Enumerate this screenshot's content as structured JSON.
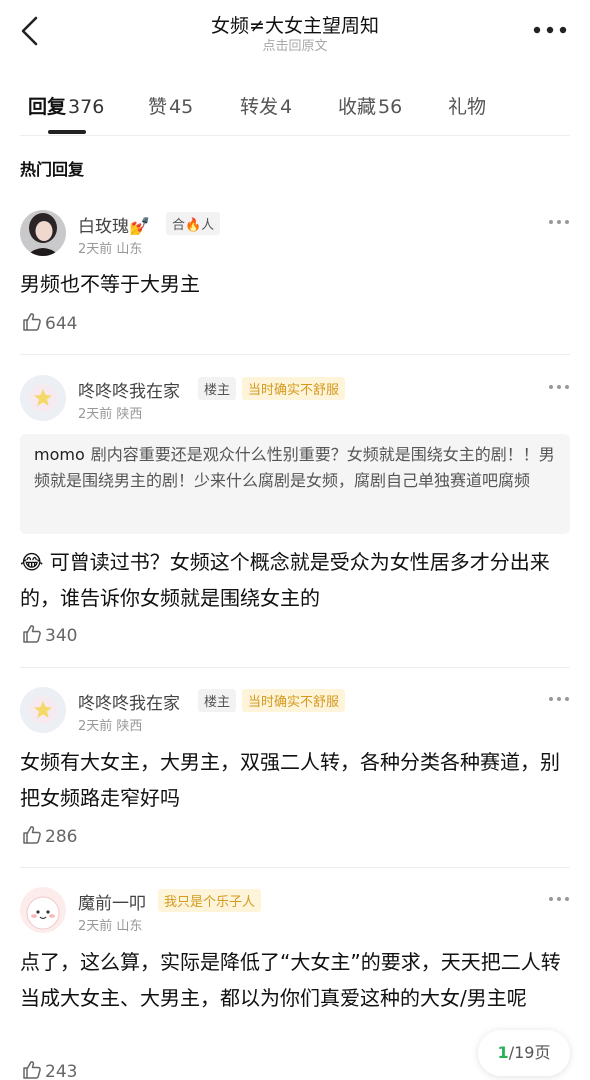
{
  "header": {
    "title": "女频≠大女主望周知",
    "subtitle": "点击回原文"
  },
  "tabs": [
    {
      "label": "回复",
      "count": "376"
    },
    {
      "label": "赞",
      "count": "45"
    },
    {
      "label": "转发",
      "count": "4"
    },
    {
      "label": "收藏",
      "count": "56"
    },
    {
      "label": "礼物",
      "count": ""
    }
  ],
  "section_title": "热门回复",
  "comments": [
    {
      "name": "白玫瑰💅",
      "badges": [
        "合🔥人"
      ],
      "time": "2天前",
      "location": "山东",
      "text": "男频也不等于大男主",
      "likes": "644"
    },
    {
      "name": "咚咚咚我在家",
      "badges": [
        "楼主",
        "当时确实不舒服"
      ],
      "time": "2天前",
      "location": "陕西",
      "quote_name": "momo",
      "quote_text": "剧内容重要还是观众什么性别重要？女频就是围绕女主的剧！！男频就是围绕男主的剧！少来什么腐剧是女频，腐剧自己单独赛道吧腐频",
      "text": "😂 可曾读过书？女频这个概念就是受众为女性居多才分出来的，谁告诉你女频就是围绕女主的",
      "likes": "340"
    },
    {
      "name": "咚咚咚我在家",
      "badges": [
        "楼主",
        "当时确实不舒服"
      ],
      "time": "2天前",
      "location": "陕西",
      "text": "女频有大女主，大男主，双强二人转，各种分类各种赛道，别把女频路走窄好吗",
      "likes": "286"
    },
    {
      "name": "魔前一叩",
      "badges": [
        "我只是个乐子人"
      ],
      "time": "2天前",
      "location": "山东",
      "text": "点了，这么算，实际是降低了“大女主”的要求，天天把二人转当成大女主、大男主，都以为你们真爱这种的大女/男主呢",
      "likes": "243"
    }
  ],
  "pager": {
    "current": "1",
    "total": "/19页"
  },
  "colors": {
    "accent_green": "#2bb05a",
    "badge_yellow_text": "#d49a1f",
    "badge_yellow_bg": "#fdf4d9"
  },
  "icons": [
    "back-arrow-icon",
    "more-icon",
    "dots-icon",
    "thumbs-up-icon",
    "avatar-star-icon"
  ]
}
